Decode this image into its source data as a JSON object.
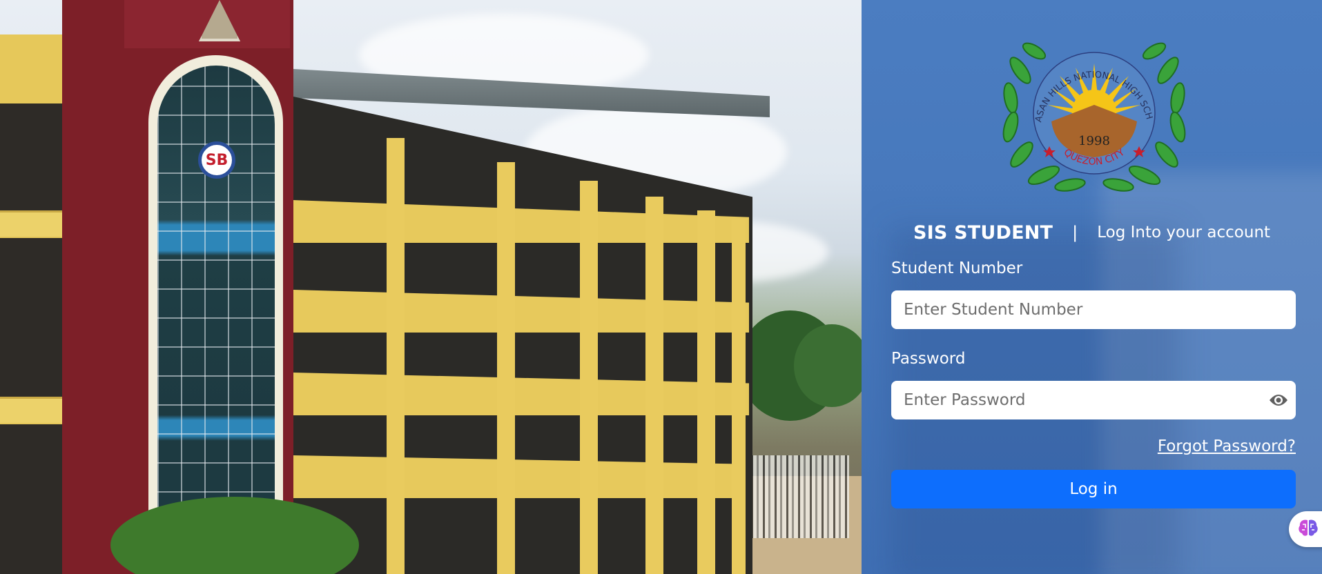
{
  "header": {
    "brand": "SIS STUDENT",
    "separator": "|",
    "tagline": "Log Into your account"
  },
  "logo": {
    "name": "school-seal-logo",
    "ring_text": "BATASAN HILLS NATIONAL HIGH SCHOOL",
    "year": "1998",
    "city": "QUEZON CITY"
  },
  "form": {
    "student_number": {
      "label": "Student Number",
      "placeholder": "Enter Student Number",
      "value": ""
    },
    "password": {
      "label": "Password",
      "placeholder": "Enter Password",
      "value": ""
    },
    "forgot_label": "Forgot Password?",
    "login_label": "Log in"
  },
  "icons": {
    "password_toggle": "eye-icon",
    "assistant": "brain-icon"
  },
  "colors": {
    "panel_bg": "#4677bb",
    "button_bg": "#0d6efd",
    "text": "#ffffff"
  }
}
